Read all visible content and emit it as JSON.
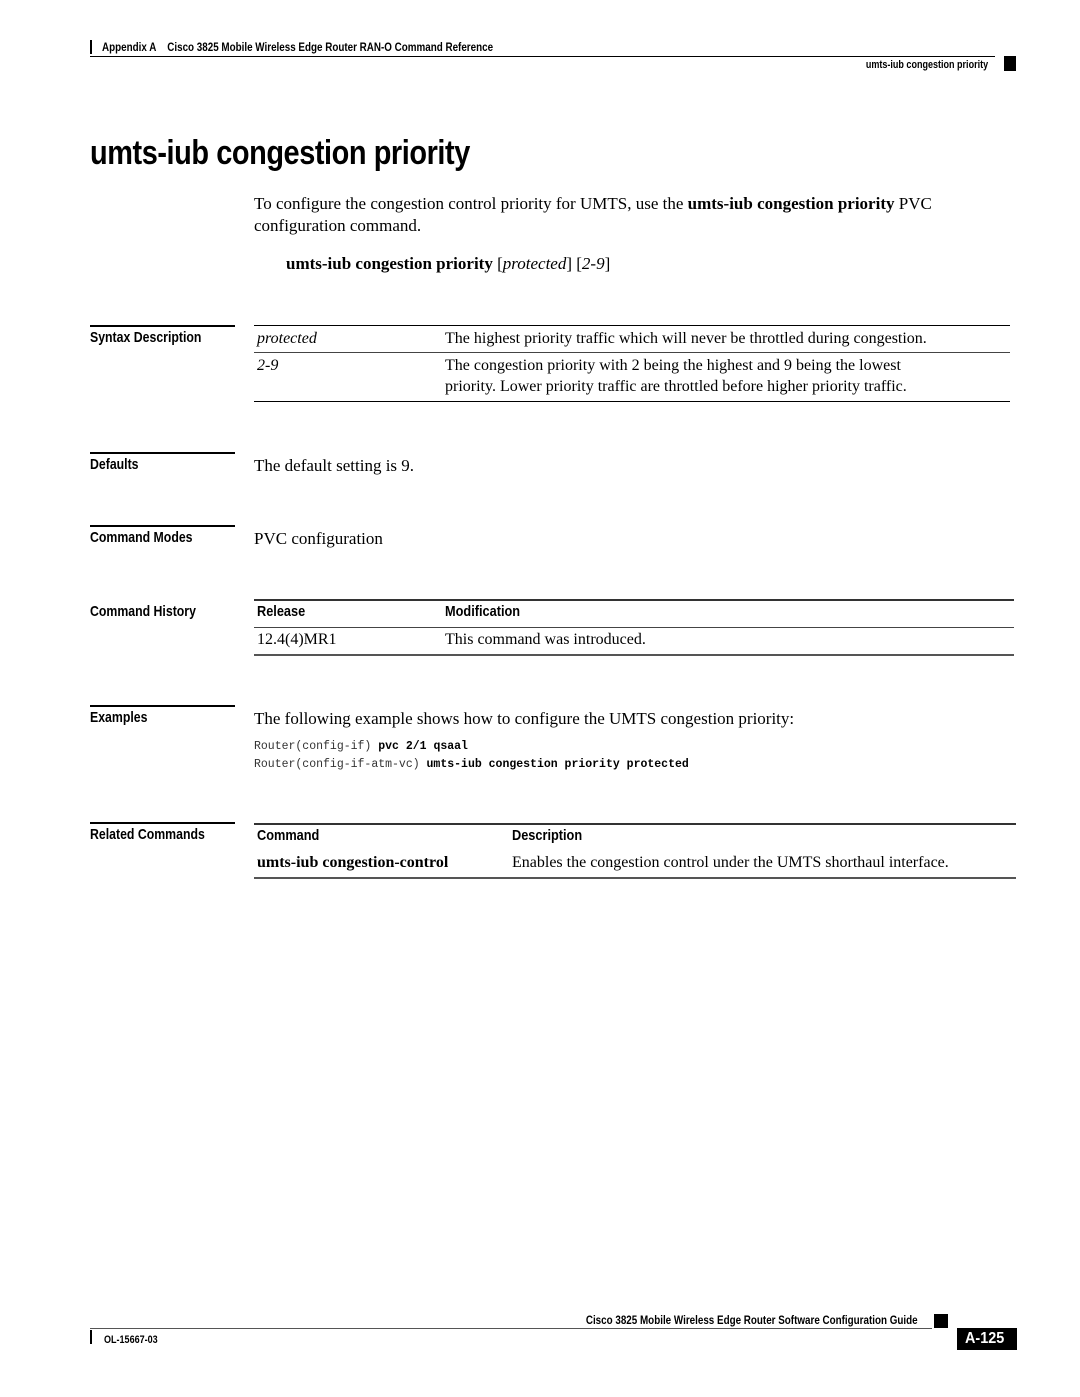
{
  "header": {
    "appendix": "Appendix A",
    "book_title": "Cisco 3825 Mobile Wireless Edge Router RAN-O Command Reference",
    "running_title": "umts-iub congestion priority"
  },
  "title": "umts-iub congestion priority",
  "intro": {
    "pre": "To configure the congestion control priority for UMTS, use the ",
    "command": "umts-iub congestion priority",
    "post": " PVC configuration command."
  },
  "syntax": {
    "command": "umts-iub congestion priority",
    "bracket_open_1": " [",
    "arg1": "protected",
    "bracket_close_1": "] [",
    "arg2": "2-9",
    "bracket_close_2": "]"
  },
  "sections": {
    "syntax_description": {
      "label": "Syntax Description",
      "rows": [
        {
          "param": "protected",
          "description": "The highest priority traffic which will never be throttled during congestion."
        },
        {
          "param": "2-9",
          "description_line1": "The congestion priority with 2 being the highest and 9 being the lowest",
          "description_line2": "priority. Lower priority traffic are throttled before higher priority traffic."
        }
      ]
    },
    "defaults": {
      "label": "Defaults",
      "text": "The default setting is 9."
    },
    "command_modes": {
      "label": "Command Modes",
      "text": "PVC configuration"
    },
    "command_history": {
      "label": "Command History",
      "headers": [
        "Release",
        "Modification"
      ],
      "rows": [
        {
          "release": "12.4(4)MR1",
          "modification": "This command was introduced."
        }
      ]
    },
    "examples": {
      "label": "Examples",
      "text": "The following example shows how to configure the UMTS congestion priority:",
      "code": [
        {
          "prompt": "Router(config-if) ",
          "command": "pvc 2/1 qsaal"
        },
        {
          "prompt": "Router(config-if-atm-vc) ",
          "command": "umts-iub congestion priority protected"
        }
      ]
    },
    "related_commands": {
      "label": "Related Commands",
      "headers": [
        "Command",
        "Description"
      ],
      "rows": [
        {
          "command": "umts-iub congestion-control",
          "description": "Enables the congestion control under the UMTS shorthaul interface."
        }
      ]
    }
  },
  "footer": {
    "guide_title": "Cisco 3825 Mobile Wireless Edge Router Software Configuration Guide",
    "doc_number": "OL-15667-03",
    "page_number": "A-125"
  }
}
